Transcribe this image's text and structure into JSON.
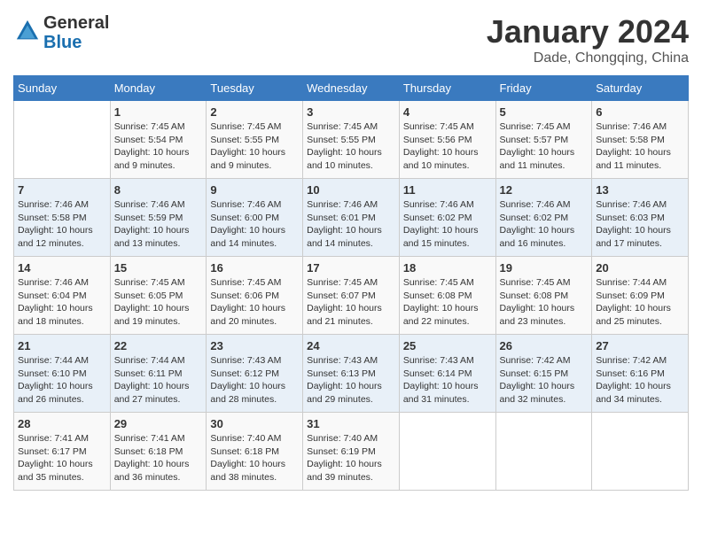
{
  "header": {
    "logo_line1": "General",
    "logo_line2": "Blue",
    "month": "January 2024",
    "location": "Dade, Chongqing, China"
  },
  "weekdays": [
    "Sunday",
    "Monday",
    "Tuesday",
    "Wednesday",
    "Thursday",
    "Friday",
    "Saturday"
  ],
  "weeks": [
    [
      {
        "day": "",
        "sunrise": "",
        "sunset": "",
        "daylight": ""
      },
      {
        "day": "1",
        "sunrise": "Sunrise: 7:45 AM",
        "sunset": "Sunset: 5:54 PM",
        "daylight": "Daylight: 10 hours and 9 minutes."
      },
      {
        "day": "2",
        "sunrise": "Sunrise: 7:45 AM",
        "sunset": "Sunset: 5:55 PM",
        "daylight": "Daylight: 10 hours and 9 minutes."
      },
      {
        "day": "3",
        "sunrise": "Sunrise: 7:45 AM",
        "sunset": "Sunset: 5:55 PM",
        "daylight": "Daylight: 10 hours and 10 minutes."
      },
      {
        "day": "4",
        "sunrise": "Sunrise: 7:45 AM",
        "sunset": "Sunset: 5:56 PM",
        "daylight": "Daylight: 10 hours and 10 minutes."
      },
      {
        "day": "5",
        "sunrise": "Sunrise: 7:45 AM",
        "sunset": "Sunset: 5:57 PM",
        "daylight": "Daylight: 10 hours and 11 minutes."
      },
      {
        "day": "6",
        "sunrise": "Sunrise: 7:46 AM",
        "sunset": "Sunset: 5:58 PM",
        "daylight": "Daylight: 10 hours and 11 minutes."
      }
    ],
    [
      {
        "day": "7",
        "sunrise": "Sunrise: 7:46 AM",
        "sunset": "Sunset: 5:58 PM",
        "daylight": "Daylight: 10 hours and 12 minutes."
      },
      {
        "day": "8",
        "sunrise": "Sunrise: 7:46 AM",
        "sunset": "Sunset: 5:59 PM",
        "daylight": "Daylight: 10 hours and 13 minutes."
      },
      {
        "day": "9",
        "sunrise": "Sunrise: 7:46 AM",
        "sunset": "Sunset: 6:00 PM",
        "daylight": "Daylight: 10 hours and 14 minutes."
      },
      {
        "day": "10",
        "sunrise": "Sunrise: 7:46 AM",
        "sunset": "Sunset: 6:01 PM",
        "daylight": "Daylight: 10 hours and 14 minutes."
      },
      {
        "day": "11",
        "sunrise": "Sunrise: 7:46 AM",
        "sunset": "Sunset: 6:02 PM",
        "daylight": "Daylight: 10 hours and 15 minutes."
      },
      {
        "day": "12",
        "sunrise": "Sunrise: 7:46 AM",
        "sunset": "Sunset: 6:02 PM",
        "daylight": "Daylight: 10 hours and 16 minutes."
      },
      {
        "day": "13",
        "sunrise": "Sunrise: 7:46 AM",
        "sunset": "Sunset: 6:03 PM",
        "daylight": "Daylight: 10 hours and 17 minutes."
      }
    ],
    [
      {
        "day": "14",
        "sunrise": "Sunrise: 7:46 AM",
        "sunset": "Sunset: 6:04 PM",
        "daylight": "Daylight: 10 hours and 18 minutes."
      },
      {
        "day": "15",
        "sunrise": "Sunrise: 7:45 AM",
        "sunset": "Sunset: 6:05 PM",
        "daylight": "Daylight: 10 hours and 19 minutes."
      },
      {
        "day": "16",
        "sunrise": "Sunrise: 7:45 AM",
        "sunset": "Sunset: 6:06 PM",
        "daylight": "Daylight: 10 hours and 20 minutes."
      },
      {
        "day": "17",
        "sunrise": "Sunrise: 7:45 AM",
        "sunset": "Sunset: 6:07 PM",
        "daylight": "Daylight: 10 hours and 21 minutes."
      },
      {
        "day": "18",
        "sunrise": "Sunrise: 7:45 AM",
        "sunset": "Sunset: 6:08 PM",
        "daylight": "Daylight: 10 hours and 22 minutes."
      },
      {
        "day": "19",
        "sunrise": "Sunrise: 7:45 AM",
        "sunset": "Sunset: 6:08 PM",
        "daylight": "Daylight: 10 hours and 23 minutes."
      },
      {
        "day": "20",
        "sunrise": "Sunrise: 7:44 AM",
        "sunset": "Sunset: 6:09 PM",
        "daylight": "Daylight: 10 hours and 25 minutes."
      }
    ],
    [
      {
        "day": "21",
        "sunrise": "Sunrise: 7:44 AM",
        "sunset": "Sunset: 6:10 PM",
        "daylight": "Daylight: 10 hours and 26 minutes."
      },
      {
        "day": "22",
        "sunrise": "Sunrise: 7:44 AM",
        "sunset": "Sunset: 6:11 PM",
        "daylight": "Daylight: 10 hours and 27 minutes."
      },
      {
        "day": "23",
        "sunrise": "Sunrise: 7:43 AM",
        "sunset": "Sunset: 6:12 PM",
        "daylight": "Daylight: 10 hours and 28 minutes."
      },
      {
        "day": "24",
        "sunrise": "Sunrise: 7:43 AM",
        "sunset": "Sunset: 6:13 PM",
        "daylight": "Daylight: 10 hours and 29 minutes."
      },
      {
        "day": "25",
        "sunrise": "Sunrise: 7:43 AM",
        "sunset": "Sunset: 6:14 PM",
        "daylight": "Daylight: 10 hours and 31 minutes."
      },
      {
        "day": "26",
        "sunrise": "Sunrise: 7:42 AM",
        "sunset": "Sunset: 6:15 PM",
        "daylight": "Daylight: 10 hours and 32 minutes."
      },
      {
        "day": "27",
        "sunrise": "Sunrise: 7:42 AM",
        "sunset": "Sunset: 6:16 PM",
        "daylight": "Daylight: 10 hours and 34 minutes."
      }
    ],
    [
      {
        "day": "28",
        "sunrise": "Sunrise: 7:41 AM",
        "sunset": "Sunset: 6:17 PM",
        "daylight": "Daylight: 10 hours and 35 minutes."
      },
      {
        "day": "29",
        "sunrise": "Sunrise: 7:41 AM",
        "sunset": "Sunset: 6:18 PM",
        "daylight": "Daylight: 10 hours and 36 minutes."
      },
      {
        "day": "30",
        "sunrise": "Sunrise: 7:40 AM",
        "sunset": "Sunset: 6:18 PM",
        "daylight": "Daylight: 10 hours and 38 minutes."
      },
      {
        "day": "31",
        "sunrise": "Sunrise: 7:40 AM",
        "sunset": "Sunset: 6:19 PM",
        "daylight": "Daylight: 10 hours and 39 minutes."
      },
      {
        "day": "",
        "sunrise": "",
        "sunset": "",
        "daylight": ""
      },
      {
        "day": "",
        "sunrise": "",
        "sunset": "",
        "daylight": ""
      },
      {
        "day": "",
        "sunrise": "",
        "sunset": "",
        "daylight": ""
      }
    ]
  ]
}
